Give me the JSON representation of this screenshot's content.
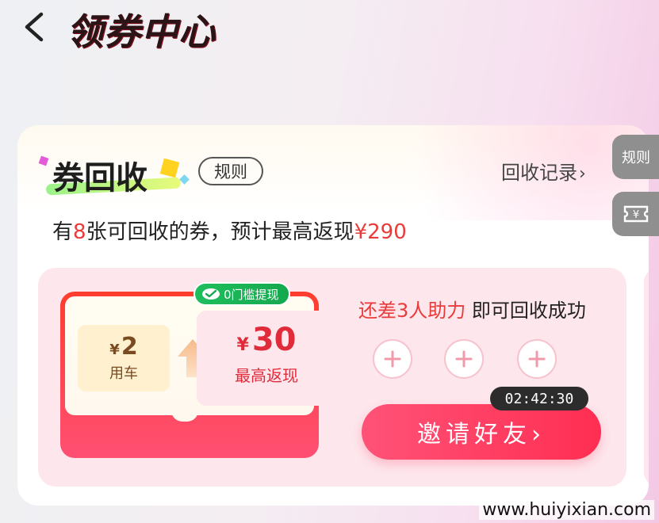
{
  "header": {
    "title": "领券中心"
  },
  "card": {
    "title": "券回收",
    "rules_label": "规则",
    "record_label": "回收记录",
    "record_chevron": "›",
    "summary": {
      "prefix": "有",
      "count": "8",
      "middle": "张可回收的券，预计最高返现",
      "amount": "¥290"
    }
  },
  "coupon": {
    "small": {
      "currency": "¥",
      "amount": "2",
      "label": "用车"
    },
    "big": {
      "currency": "¥",
      "amount": "30",
      "label": "最高返现"
    },
    "badge": "0门槛提现"
  },
  "help": {
    "highlight": "还差3人助力",
    "suffix": " 即可回收成功"
  },
  "plus_symbol": "+",
  "timer": "02:42:30",
  "invite_label": "邀请好友›",
  "side_tabs": {
    "rules": "规则",
    "coupon_icon_text": "¥"
  },
  "watermark": "www.huiyixian.com",
  "colors": {
    "accent_red": "#ea3b3b",
    "invite_pink": "#ff2e52",
    "wechat_green": "#1fbe5d"
  }
}
